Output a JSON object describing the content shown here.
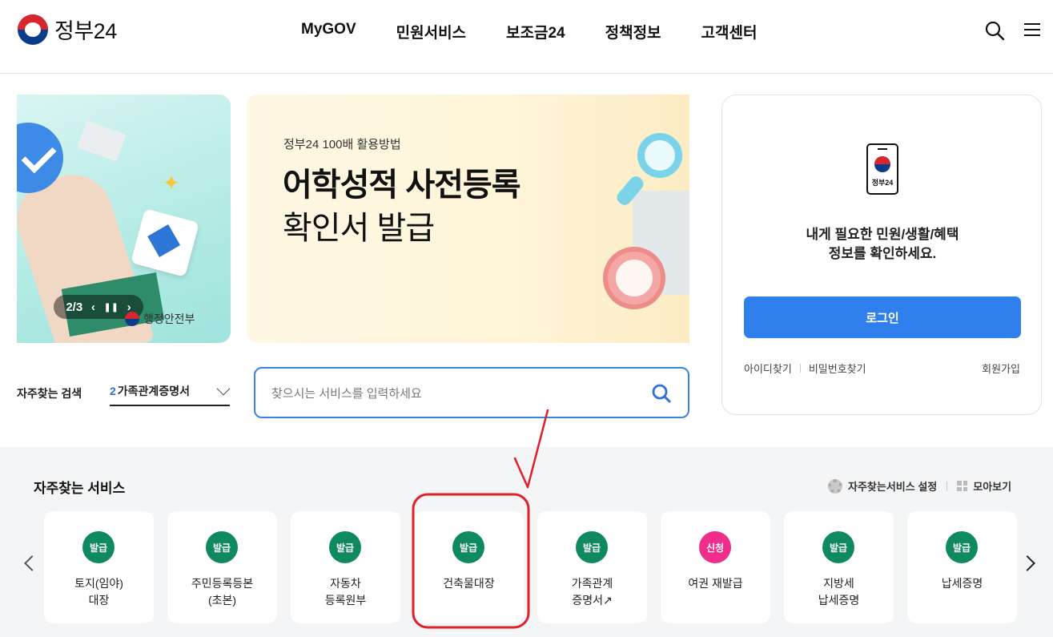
{
  "header": {
    "logo_text": "정부24",
    "nav": [
      "MyGOV",
      "민원서비스",
      "보조금24",
      "정책정보",
      "고객센터"
    ],
    "icons": [
      "search-icon",
      "hamburger-menu-icon"
    ]
  },
  "banner_left": {
    "pager": "2/3",
    "org": "행정안전부"
  },
  "banner_main": {
    "subtitle": "정부24 100배 활용방법",
    "title_line1": "어학성적 사전등록",
    "title_line2": "확인서 발급"
  },
  "login": {
    "app_label": "정부24",
    "message_line1": "내게 필요한 민원/생활/혜택",
    "message_line2": "정보를 확인하세요.",
    "login_button": "로그인",
    "find_id": "아이디찾기",
    "find_pw": "비밀번호찾기",
    "join": "회원가입"
  },
  "search": {
    "label": "자주찾는 검색",
    "selected_num": "2",
    "selected_text": "가족관계증명서",
    "placeholder": "찾으시는 서비스를 입력하세요"
  },
  "favorites": {
    "title": "자주찾는 서비스",
    "settings": "자주찾는서비스 설정",
    "view_all": "모아보기",
    "items": [
      {
        "badge": "발급",
        "line1": "토지(임야)",
        "line2": "대장"
      },
      {
        "badge": "발급",
        "line1": "주민등록등본",
        "line2": "(초본)"
      },
      {
        "badge": "발급",
        "line1": "자동차",
        "line2": "등록원부"
      },
      {
        "badge": "발급",
        "line1": "건축물대장",
        "line2": ""
      },
      {
        "badge": "발급",
        "line1": "가족관계",
        "line2": "증명서↗"
      },
      {
        "badge": "신청",
        "line1": "여권 재발급",
        "line2": ""
      },
      {
        "badge": "발급",
        "line1": "지방세",
        "line2": "납세증명"
      },
      {
        "badge": "발급",
        "line1": "납세증명",
        "line2": ""
      }
    ]
  },
  "colors": {
    "primary_blue": "#2f80ed",
    "badge_green": "#0f8a5f",
    "badge_pink": "#ef2d8a",
    "annotation_red": "#e0212a"
  }
}
